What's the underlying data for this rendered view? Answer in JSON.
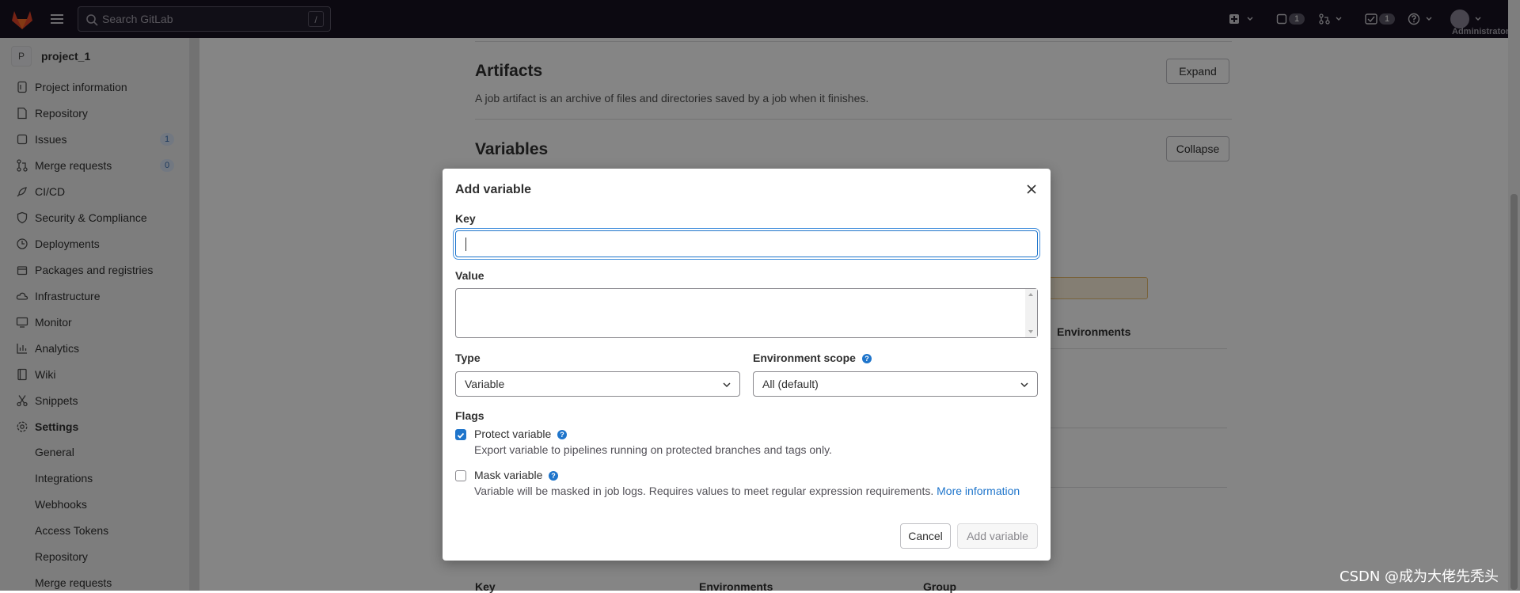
{
  "topbar": {
    "search_placeholder": "Search GitLab",
    "search_shortcut": "/",
    "merge_requests_count": "1",
    "todos_count": "1",
    "user_label": "Administrator"
  },
  "sidebar": {
    "project_initial": "P",
    "project_name": "project_1",
    "items": [
      {
        "label": "Project information",
        "icon": "project-icon"
      },
      {
        "label": "Repository",
        "icon": "doc-icon"
      },
      {
        "label": "Issues",
        "icon": "issues-icon",
        "count": "1"
      },
      {
        "label": "Merge requests",
        "icon": "merge-request-icon",
        "count": "0"
      },
      {
        "label": "CI/CD",
        "icon": "rocket-icon"
      },
      {
        "label": "Security & Compliance",
        "icon": "shield-icon"
      },
      {
        "label": "Deployments",
        "icon": "deployments-icon"
      },
      {
        "label": "Packages and registries",
        "icon": "package-icon"
      },
      {
        "label": "Infrastructure",
        "icon": "cloud-icon"
      },
      {
        "label": "Monitor",
        "icon": "monitor-icon"
      },
      {
        "label": "Analytics",
        "icon": "chart-icon"
      },
      {
        "label": "Wiki",
        "icon": "book-icon"
      },
      {
        "label": "Snippets",
        "icon": "snippet-icon"
      },
      {
        "label": "Settings",
        "icon": "gear-icon"
      }
    ],
    "settings_sub": [
      "General",
      "Integrations",
      "Webhooks",
      "Access Tokens",
      "Repository",
      "Merge requests"
    ]
  },
  "main": {
    "artifacts_title": "Artifacts",
    "artifacts_desc": "A job artifact is an archive of files and directories saved by a job when it finishes.",
    "expand_label": "Expand",
    "variables_title": "Variables",
    "collapse_label": "Collapse",
    "environments_header": "Environments",
    "table_headers": [
      "Key",
      "Environments",
      "Group"
    ]
  },
  "modal": {
    "title": "Add variable",
    "key_label": "Key",
    "key_value": "",
    "value_label": "Value",
    "type_label": "Type",
    "type_value": "Variable",
    "scope_label": "Environment scope",
    "scope_value": "All (default)",
    "flags_label": "Flags",
    "protect_label": "Protect variable",
    "protect_checked": true,
    "protect_help": "Export variable to pipelines running on protected branches and tags only.",
    "mask_label": "Mask variable",
    "mask_checked": false,
    "mask_help": "Variable will be masked in job logs. Requires values to meet regular expression requirements.",
    "mask_link": "More information",
    "cancel_label": "Cancel",
    "submit_label": "Add variable"
  },
  "watermark": "CSDN @成为大佬先秃头",
  "colors": {
    "accent": "#1f75cb",
    "topbar": "#171321"
  }
}
